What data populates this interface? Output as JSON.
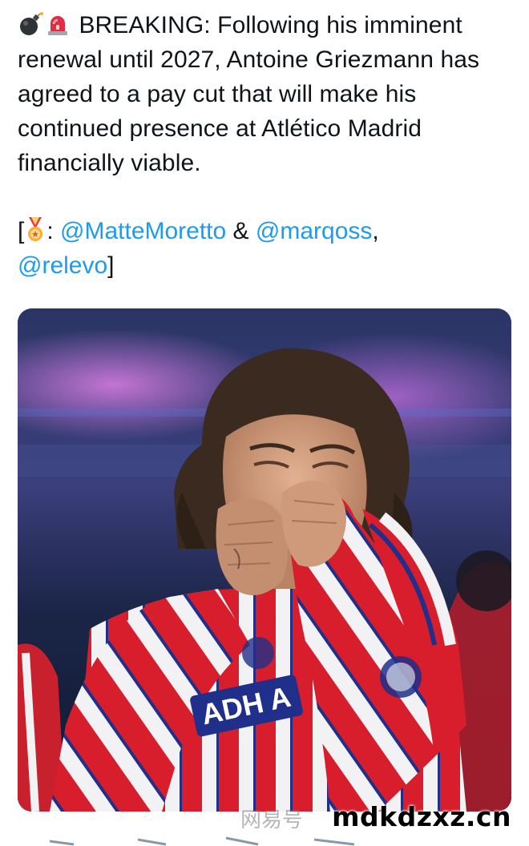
{
  "tweet": {
    "emoji_bomb": "bomb-emoji",
    "emoji_siren": "siren-emoji",
    "body": "BREAKING: Following his imminent renewal until 2027, Antoine Griezmann has agreed to a pay cut that will make his continued presence at Atlético Madrid financially viable.",
    "credits": {
      "open_bracket": "[",
      "medal_icon": "medal-emoji",
      "colon": ": ",
      "mention_1": "@MatteMoretto",
      "ampersand": " & ",
      "mention_2": "@marqoss",
      "comma": ",",
      "mention_3": "@relevo",
      "close_bracket": "]"
    }
  },
  "media": {
    "jersey_sponsor": "ADH A"
  },
  "watermark": {
    "site": "mdkdzxz.cn",
    "faint_text": "网易号"
  },
  "colors": {
    "mention": "#1d9bf0",
    "text": "#0f1419",
    "jersey_red": "#d81e2c",
    "jersey_blue": "#1f2f8a"
  }
}
